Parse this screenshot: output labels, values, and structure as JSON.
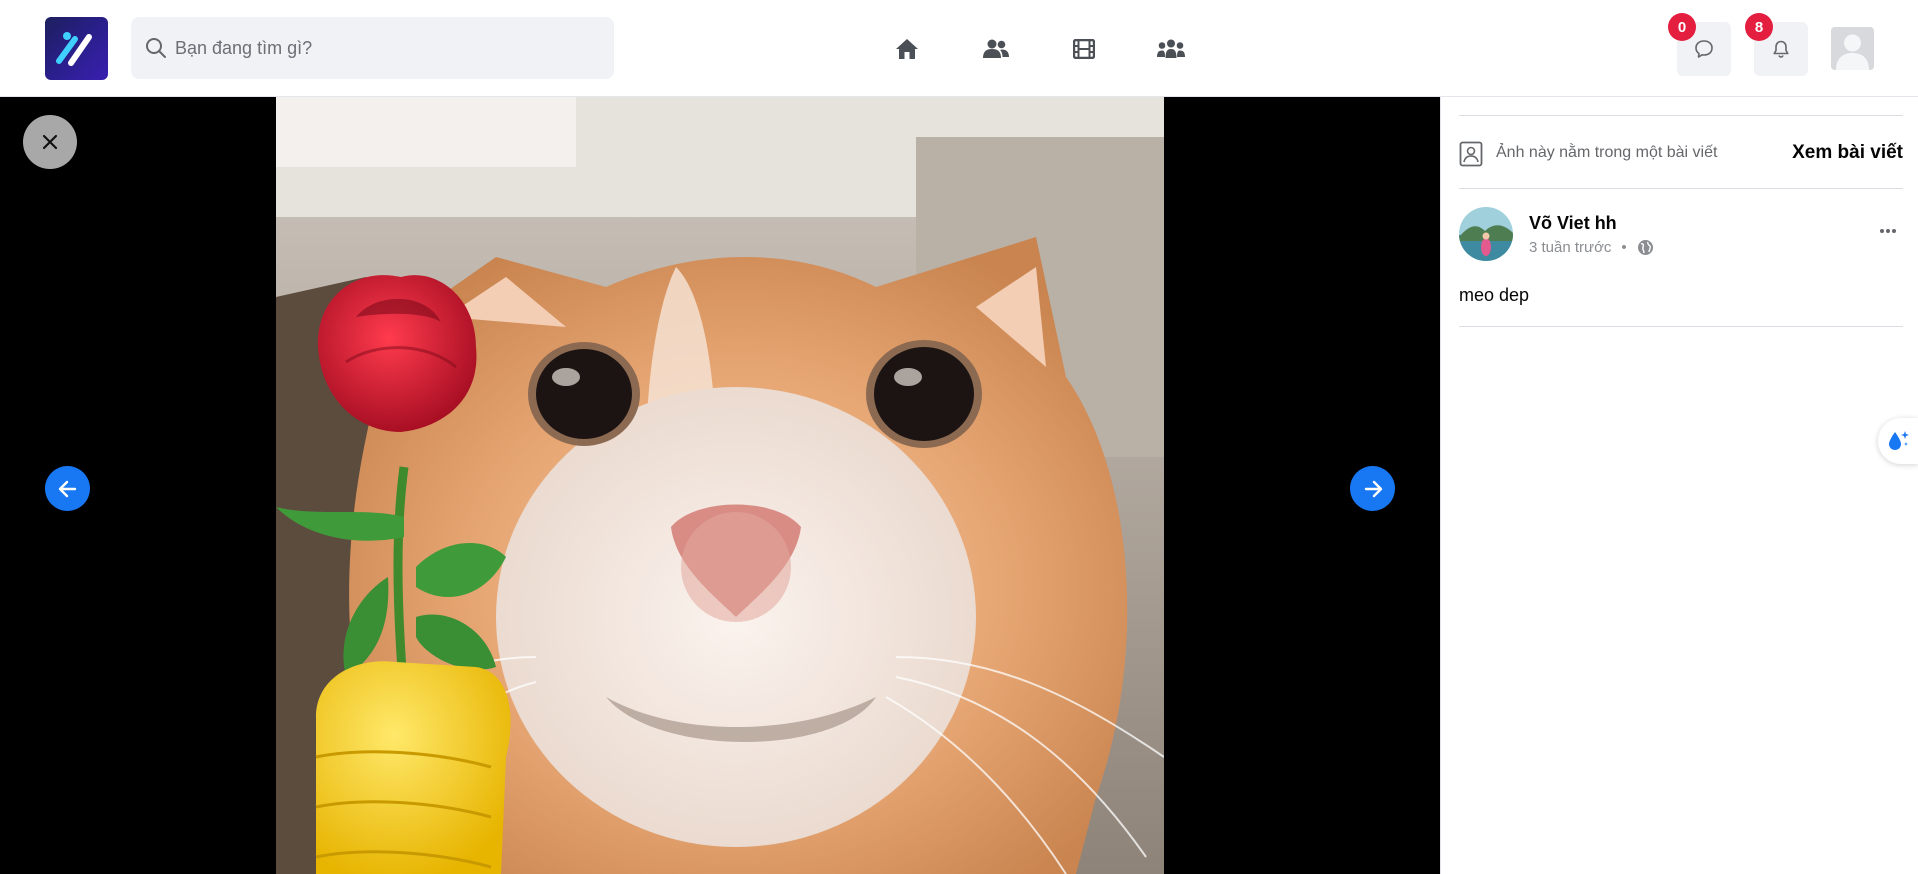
{
  "search": {
    "placeholder": "Bạn đang tìm gì?"
  },
  "nav": [
    {
      "icon": "home-icon"
    },
    {
      "icon": "friends-icon"
    },
    {
      "icon": "video-icon"
    },
    {
      "icon": "groups-icon"
    }
  ],
  "header": {
    "messages_count": "0",
    "notifications_count": "8"
  },
  "panel": {
    "post_hint": "Ảnh này nằm trong một bài viết",
    "see_post_label": "Xem bài viết",
    "author_name": "Võ Viet hh",
    "post_time": "3 tuần trước",
    "post_time_separator": "•",
    "post_text": "meo dep"
  },
  "colors": {
    "accent": "#1877f2",
    "badge": "#e41e3f",
    "viewer_bg": "#000000"
  }
}
